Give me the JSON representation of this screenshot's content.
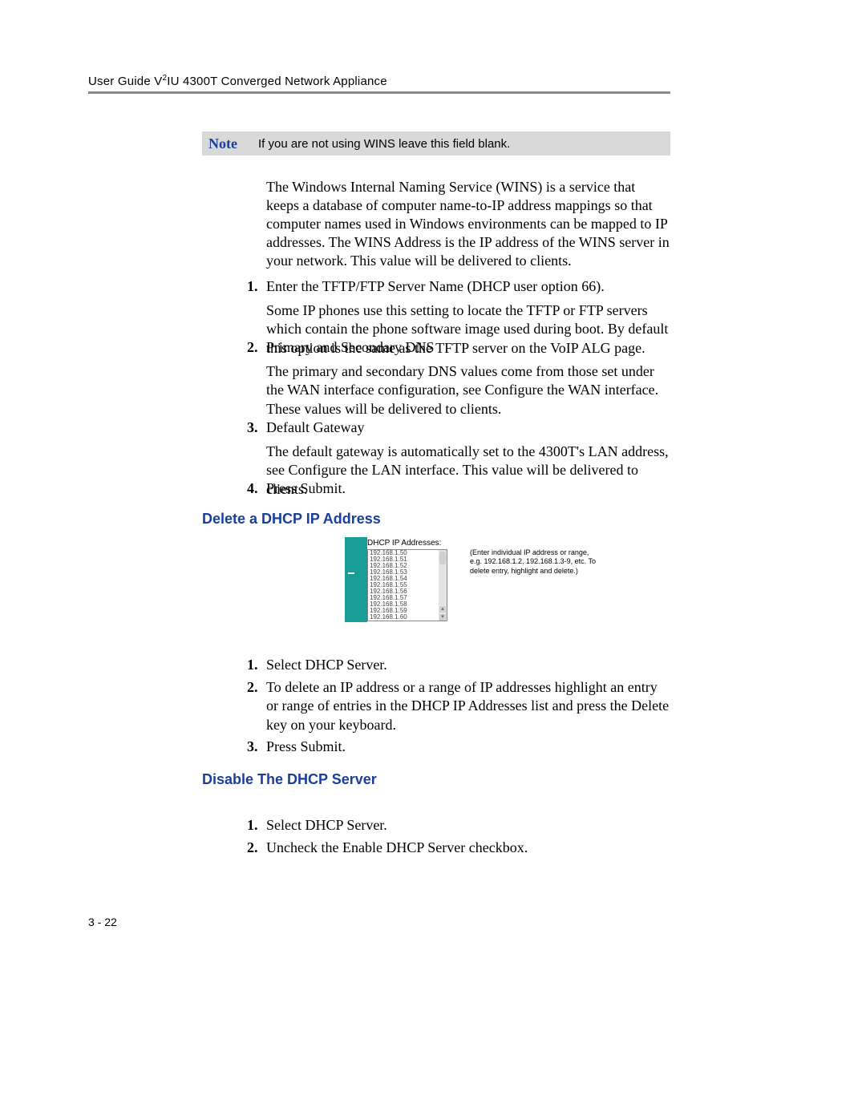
{
  "header": {
    "title_pre": "User Guide V",
    "title_sup": "2",
    "title_post": "IU 4300T Converged Network Appliance"
  },
  "note": {
    "label": "Note",
    "text": "If you are not using WINS leave this field blank."
  },
  "intro_para": "The Windows Internal Naming Service (WINS) is a service that keeps a database of computer name-to-IP address mappings so that computer names used in Windows environments can be mapped to IP addresses. The WINS Address is the IP address of the WINS server in your network. This value will be delivered to clients.",
  "list1": {
    "items": [
      {
        "num": "1.",
        "text": "Enter the TFTP/FTP Server Name (DHCP user option 66).",
        "sub": "Some IP phones use this setting to locate the TFTP or FTP servers which contain the phone software image used during boot.  By default this option is the same as the TFTP server on the VoIP ALG page."
      },
      {
        "num": "2.",
        "text": "Primary and Secondary DNS",
        "sub": "The primary and secondary DNS values come from those set under the WAN interface configuration, see Configure the WAN interface. These values will be delivered to clients."
      },
      {
        "num": "3.",
        "text": "Default Gateway",
        "sub": "The default gateway is automatically set to the 4300T's LAN address, see Configure the LAN interface.  This value will be delivered to clients."
      },
      {
        "num": "4.",
        "text": "Press Submit.",
        "sub": ""
      }
    ]
  },
  "h4_delete": "Delete a DHCP IP Address",
  "screenshot": {
    "label": "DHCP IP Addresses:",
    "ips": [
      "192.168.1.50",
      "192.168.1.51",
      "192.168.1.52",
      "192.168.1.53",
      "192.168.1.54",
      "192.168.1.55",
      "192.168.1.56",
      "192.168.1.57",
      "192.168.1.58",
      "192.168.1.59",
      "192.168.1.60"
    ],
    "hint": "(Enter individual IP address or range, e.g. 192.168.1.2, 192.168.1.3-9, etc. To delete entry, highlight and delete.)"
  },
  "list2": {
    "items": [
      {
        "num": "1.",
        "text": "Select DHCP Server."
      },
      {
        "num": "2.",
        "text": "To delete an IP address or a range of IP addresses highlight an  entry or range of entries in the DHCP IP Addresses list and press the Delete key on your keyboard."
      },
      {
        "num": "3.",
        "text": "Press Submit."
      }
    ]
  },
  "h4_disable": "Disable The DHCP Server",
  "list3": {
    "items": [
      {
        "num": "1.",
        "text": "Select DHCP Server."
      },
      {
        "num": "2.",
        "text": "Uncheck the Enable DHCP Server checkbox."
      }
    ]
  },
  "footer": "3 - 22"
}
